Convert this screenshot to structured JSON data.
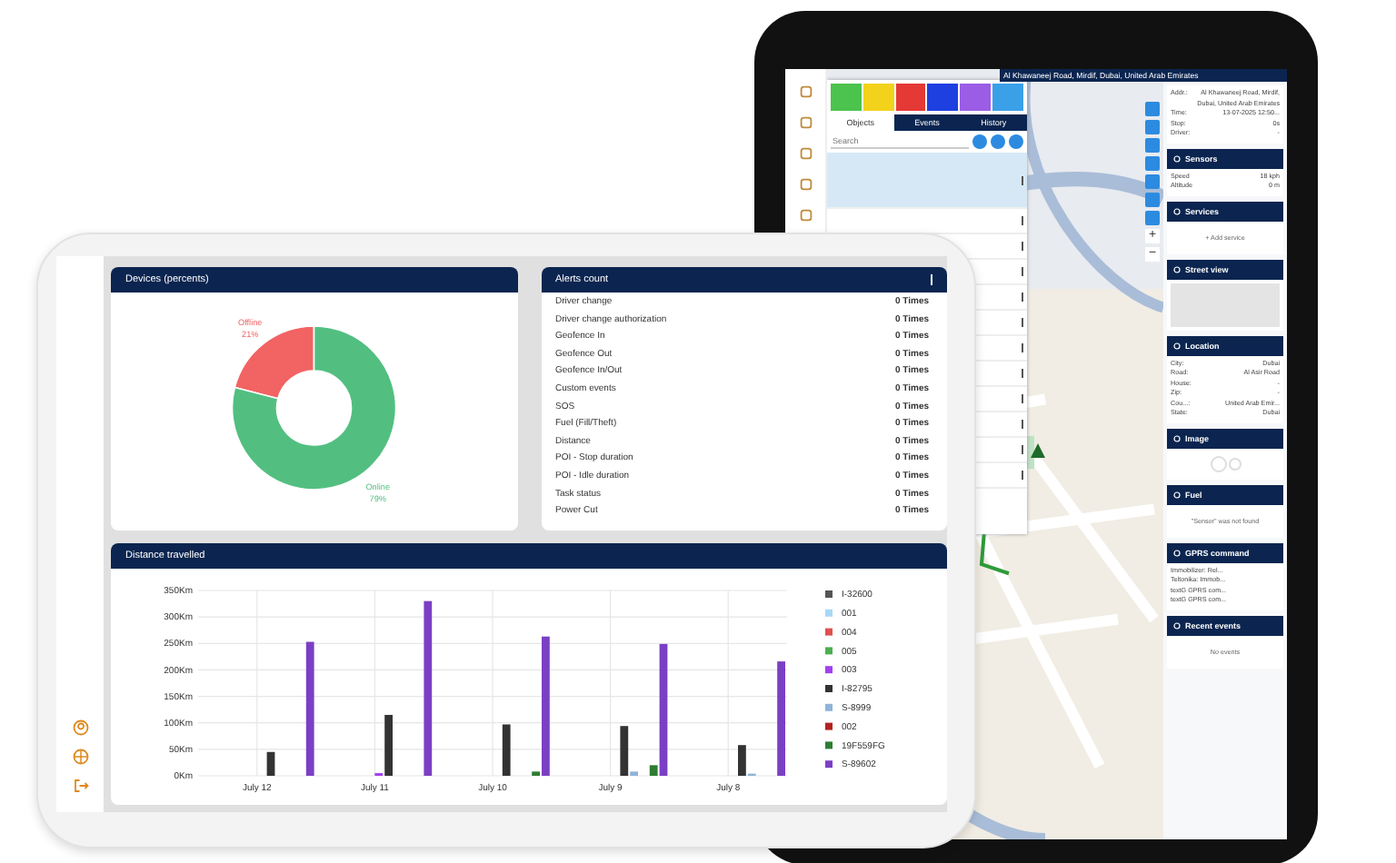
{
  "back_tablet": {
    "address": "Al Khawaneej Road, Mirdif, Dubai, United Arab Emirates",
    "status_tiles": [
      {
        "color": "#4cc34c"
      },
      {
        "color": "#f2d21b"
      },
      {
        "color": "#e53935"
      },
      {
        "color": "#1e40e0"
      },
      {
        "color": "#9b5de5"
      },
      {
        "color": "#3aa0e8"
      }
    ],
    "tabs": [
      {
        "label": "Objects",
        "selected": true
      },
      {
        "label": "Events",
        "selected": false
      },
      {
        "label": "History",
        "selected": false
      }
    ],
    "search": {
      "placeholder": "Search"
    },
    "object_rows": [
      {
        "selected": true
      },
      {
        "selected": false
      },
      {
        "selected": false
      },
      {
        "selected": false
      },
      {
        "selected": false
      },
      {
        "selected": false
      },
      {
        "selected": false
      },
      {
        "selected": false
      },
      {
        "selected": false
      },
      {
        "selected": false
      },
      {
        "selected": false
      },
      {
        "selected": false
      }
    ],
    "map_zoom": [
      "+",
      "−"
    ],
    "sections": [
      {
        "kind": "fields",
        "rows": [
          {
            "label": "Addr.:",
            "value": "Al Khawaneej Road, Mirdif, Dubai, United Arab Emirates"
          },
          {
            "label": "Time:",
            "value": "13-07-2025 12:50..."
          },
          {
            "label": "Stop:",
            "value": "0s"
          },
          {
            "label": "Driver:",
            "value": "-"
          }
        ]
      },
      {
        "kind": "fields",
        "title": "Sensors",
        "rows": [
          {
            "label": "Speed",
            "value": "18 kph"
          },
          {
            "label": "Altitude",
            "value": "0 m"
          }
        ]
      },
      {
        "kind": "note",
        "title": "Services",
        "note": "+ Add service"
      },
      {
        "title": "Street view"
      },
      {
        "kind": "fields",
        "title": "Location",
        "rows": [
          {
            "label": "City:",
            "value": "Dubai"
          },
          {
            "label": "Road:",
            "value": "Al Asir Road"
          },
          {
            "label": "House:",
            "value": "-"
          },
          {
            "label": "Zip:",
            "value": "-"
          },
          {
            "label": "Cou...:",
            "value": "United Arab Emir..."
          },
          {
            "label": "State:",
            "value": "Dubai"
          }
        ]
      },
      {
        "kind": "note",
        "title": "Image"
      },
      {
        "kind": "note",
        "title": "Fuel",
        "note": "\"Sensor\" was not found"
      },
      {
        "kind": "list",
        "title": "GPRS command",
        "items": [
          "Immobilizer: Rel...",
          "Teltonika: Immob...",
          "textG GPRS com...",
          "textG GPRS com..."
        ]
      },
      {
        "kind": "note",
        "title": "Recent events",
        "note": "No events"
      }
    ]
  },
  "front_tablet": {
    "devices": {
      "title": "Devices (percents)",
      "chart_data": {
        "type": "donut",
        "categories": [
          "Offline",
          "Online"
        ],
        "values": [
          21,
          79
        ]
      },
      "slices": [
        {
          "percent": "21%",
          "color": "#f26363"
        },
        {
          "percent": "79%",
          "color": "#52bf80"
        }
      ]
    },
    "alerts": {
      "title": "Alerts count",
      "rows": [
        {
          "name": "Driver change",
          "count": "0 Times"
        },
        {
          "name": "Driver change authorization",
          "count": "0 Times"
        },
        {
          "name": "Geofence In",
          "count": "0 Times"
        },
        {
          "name": "Geofence Out",
          "count": "0 Times"
        },
        {
          "name": "Geofence In/Out",
          "count": "0 Times"
        },
        {
          "name": "Custom events",
          "count": "0 Times"
        },
        {
          "name": "SOS",
          "count": "0 Times"
        },
        {
          "name": "Fuel (Fill/Theft)",
          "count": "0 Times"
        },
        {
          "name": "Distance",
          "count": "0 Times"
        },
        {
          "name": "POI - Stop duration",
          "count": "0 Times"
        },
        {
          "name": "POI - Idle duration",
          "count": "0 Times"
        },
        {
          "name": "Task status",
          "count": "0 Times"
        },
        {
          "name": "Power Cut",
          "count": "0 Times"
        }
      ]
    },
    "distance": {
      "title": "Distance travelled",
      "chart_data": {
        "type": "bar",
        "grid": true,
        "legend": "right",
        "categories": [
          "July 12",
          "July 11",
          "July 10",
          "July 9",
          "July 8"
        ],
        "ylim": [
          0,
          350
        ],
        "yticks": [
          {
            "value": 0,
            "label": "0Km"
          },
          {
            "value": 50,
            "label": "50Km"
          },
          {
            "value": 100,
            "label": "100Km"
          },
          {
            "value": 150,
            "label": "150Km"
          },
          {
            "value": 200,
            "label": "200Km"
          },
          {
            "value": 250,
            "label": "250Km"
          },
          {
            "value": 300,
            "label": "300Km"
          },
          {
            "value": 350,
            "label": "350Km"
          }
        ],
        "series": [
          {
            "name": "I-32600",
            "color": "#555555",
            "values": [
              null,
              null,
              null,
              null,
              null
            ]
          },
          {
            "name": "001",
            "color": "#a8d8f8",
            "values": [
              null,
              null,
              null,
              null,
              null
            ]
          },
          {
            "name": "004",
            "color": "#e05050",
            "values": [
              null,
              null,
              null,
              null,
              null
            ]
          },
          {
            "name": "005",
            "color": "#4caf50",
            "values": [
              null,
              null,
              null,
              null,
              null
            ]
          },
          {
            "name": "003",
            "color": "#a040f0",
            "values": [
              null,
              5,
              null,
              null,
              null
            ]
          },
          {
            "name": "I-82795",
            "color": "#333333",
            "values": [
              45,
              115,
              97,
              94,
              58
            ]
          },
          {
            "name": "S-8999",
            "color": "#8fb3d9",
            "values": [
              null,
              null,
              null,
              8,
              4
            ]
          },
          {
            "name": "002",
            "color": "#b22222",
            "values": [
              null,
              null,
              null,
              null,
              null
            ]
          },
          {
            "name": "19F559FG",
            "color": "#2e7d32",
            "values": [
              null,
              null,
              8,
              20,
              null
            ]
          },
          {
            "name": "S-89602",
            "color": "#7b3fc4",
            "values": [
              253,
              330,
              263,
              249,
              216
            ]
          }
        ]
      }
    }
  }
}
